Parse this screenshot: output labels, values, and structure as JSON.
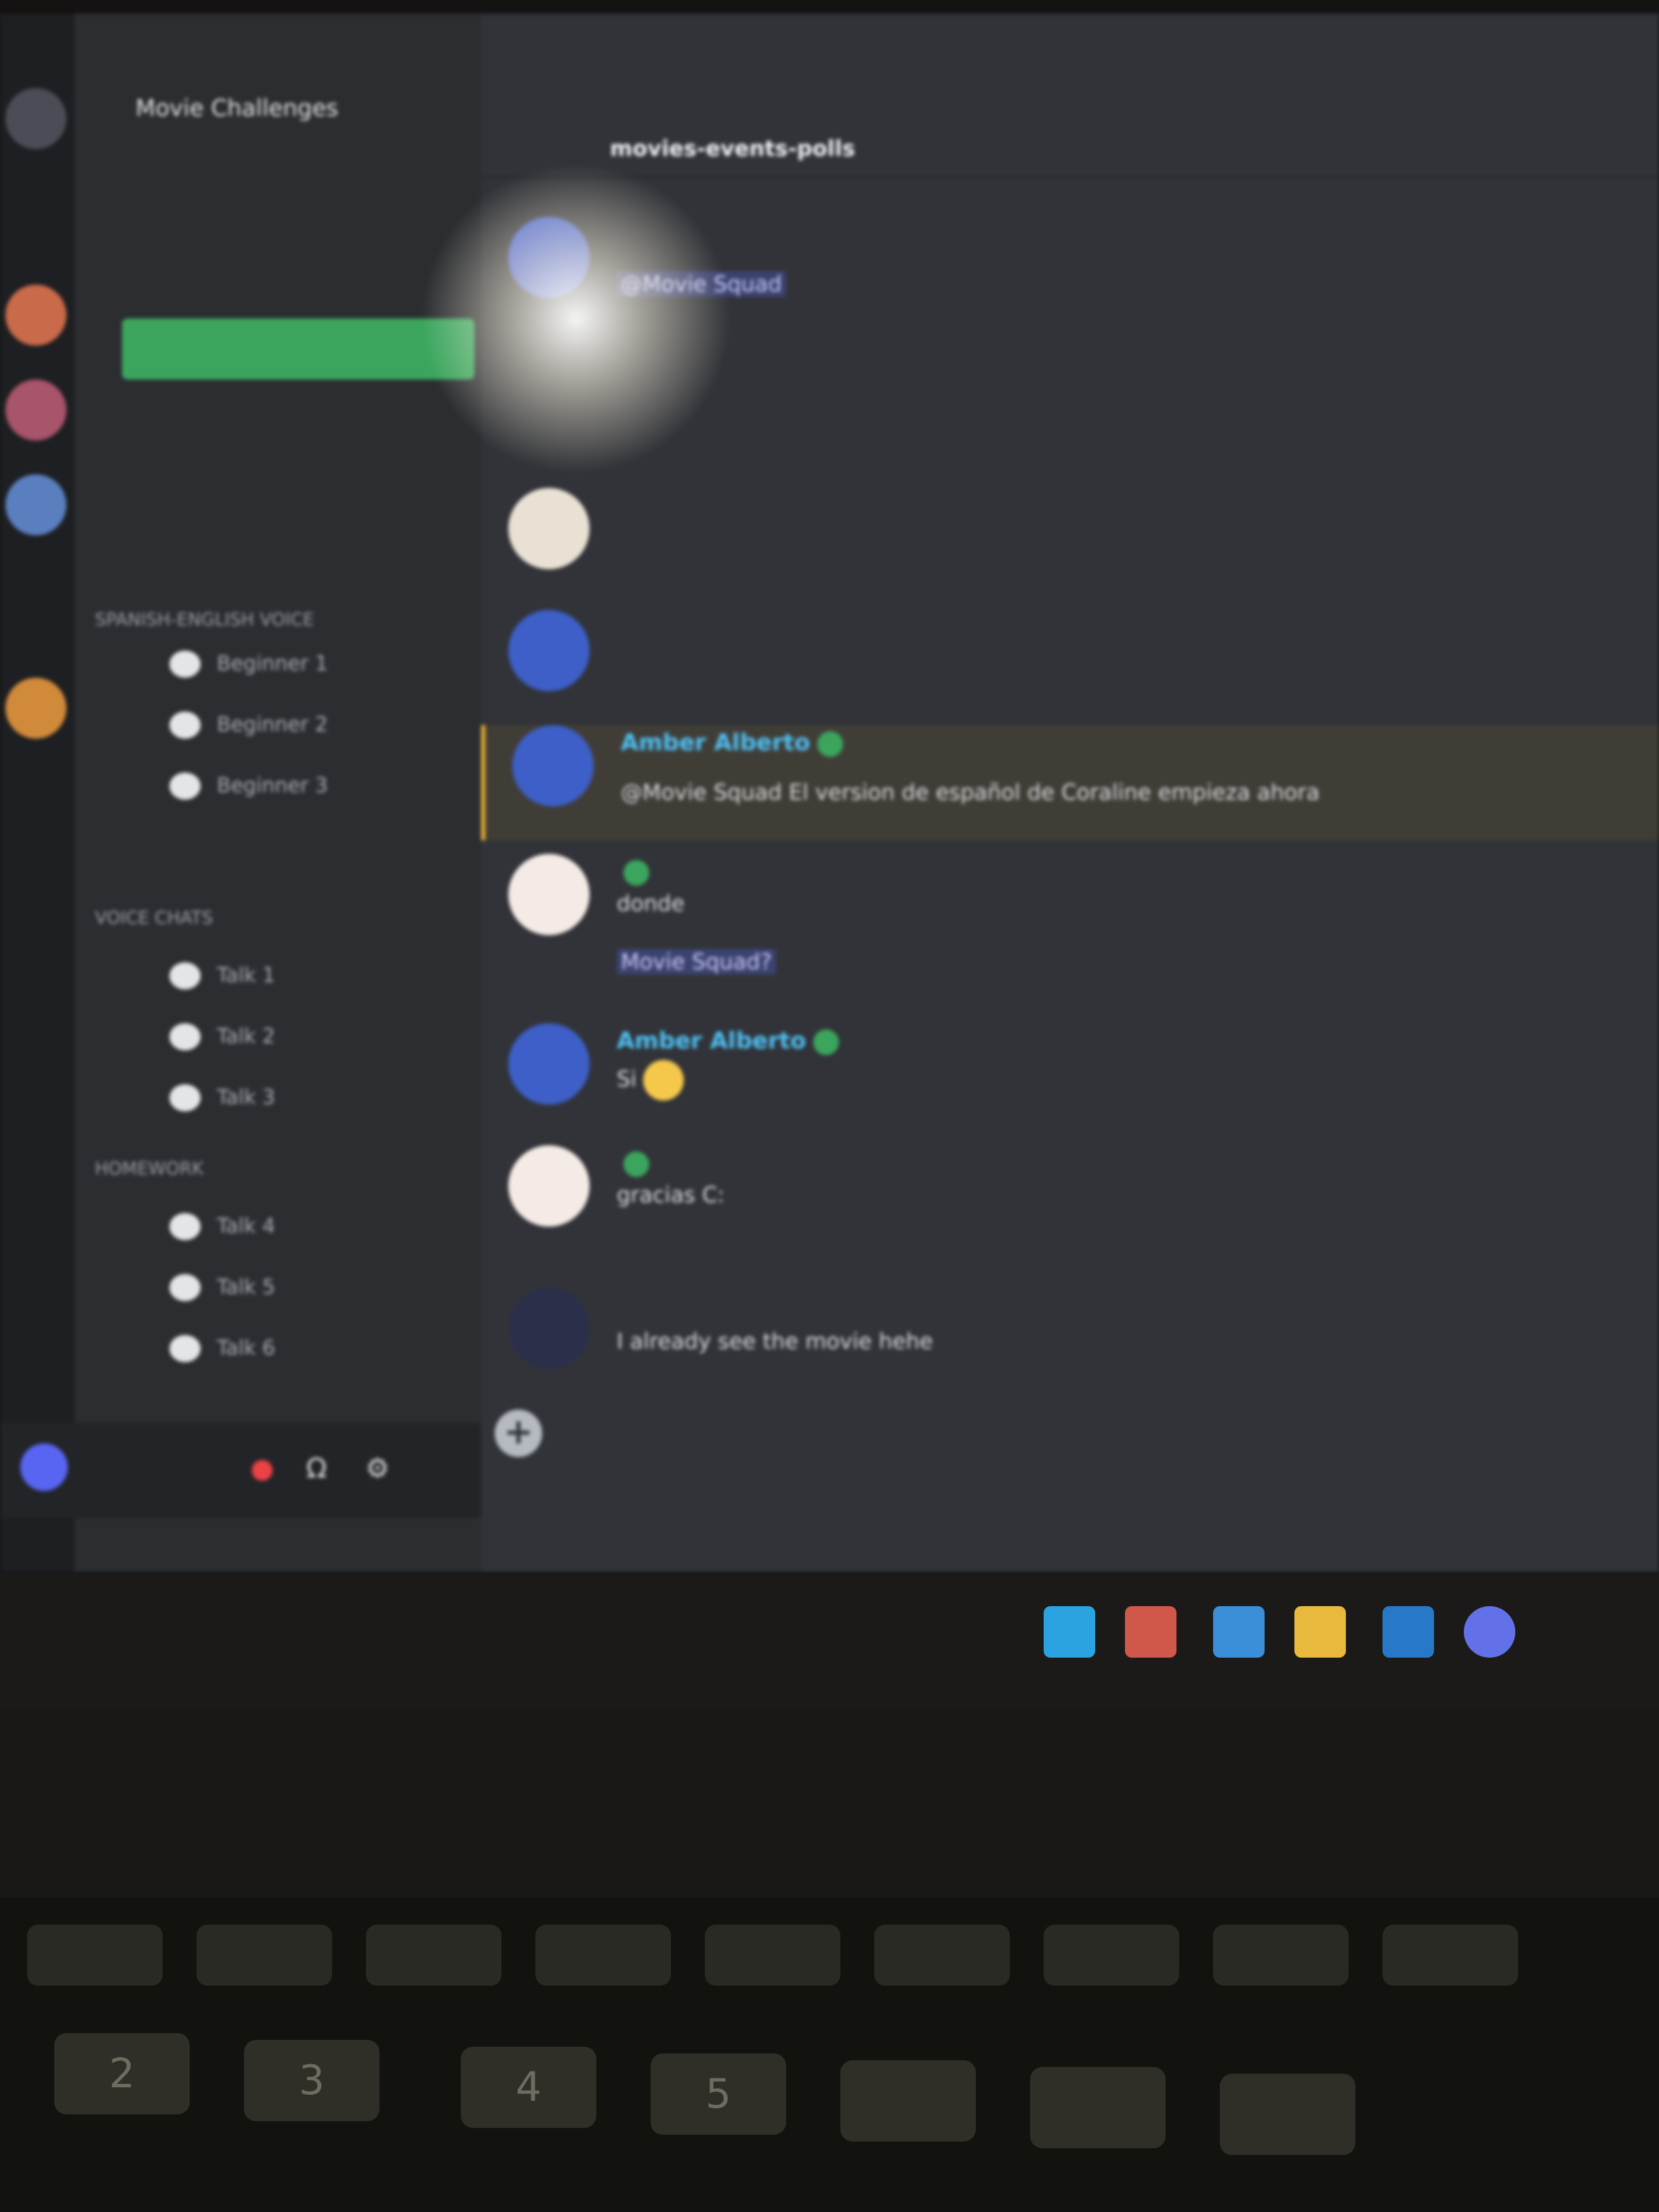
{
  "channel_sidebar": {
    "server_title": "Movie Challenges",
    "event_banner_label": "",
    "categories": [
      {
        "label": "Spanish-English Voice"
      },
      {
        "label": "Voice Chats"
      },
      {
        "label": "Homework"
      }
    ],
    "voice_channels": [
      {
        "count": "",
        "name": "Beginner 1",
        "limit": ""
      },
      {
        "count": "",
        "name": "Beginner 2",
        "limit": ""
      },
      {
        "count": "",
        "name": "Beginner 3",
        "limit": ""
      },
      {
        "count": "",
        "name": "Talk 1",
        "limit": ""
      },
      {
        "count": "",
        "name": "Talk 2",
        "limit": ""
      },
      {
        "count": "",
        "name": "Talk 3",
        "limit": ""
      },
      {
        "count": "",
        "name": "Talk 4",
        "limit": ""
      },
      {
        "count": "",
        "name": "Talk 5",
        "limit": ""
      },
      {
        "count": "",
        "name": "Talk 6",
        "limit": ""
      }
    ]
  },
  "user_panel": {
    "username": "",
    "status": ""
  },
  "header": {
    "channel_name": "movies-events-polls",
    "topic": ""
  },
  "messages": [
    {
      "author": "",
      "author_color": "#8ea1e1",
      "timestamp": "",
      "text": "@Movie Squad"
    },
    {
      "author": "",
      "author_color": "#d4a017",
      "timestamp": "",
      "text": ""
    },
    {
      "author": "",
      "author_color": "#d4a017",
      "timestamp": "",
      "text": ""
    },
    {
      "author": "",
      "author_color": "#4fc3f7",
      "timestamp": "",
      "text": ""
    },
    {
      "author": "Amber Alberto",
      "author_color": "#4fc3f7",
      "timestamp": "",
      "text": "@Movie Squad  El version de español de Coraline empieza ahora"
    },
    {
      "author": "",
      "author_color": "#3ba55d",
      "timestamp": "",
      "text": "donde",
      "extra": "Movie Squad?"
    },
    {
      "author": "Amber Alberto",
      "author_color": "#4fc3f7",
      "timestamp": "",
      "text": "Si"
    },
    {
      "author": "",
      "author_color": "#3ba55d",
      "timestamp": "",
      "text": "gracias C:"
    },
    {
      "author": "",
      "author_color": "#5aa9ff",
      "timestamp": "",
      "reply": "",
      "text": "I already see the movie hehe"
    }
  ],
  "composer": {
    "placeholder": ""
  },
  "colors": {
    "background": "#313338",
    "sidebar": "#2b2d31",
    "rail": "#1e1f22",
    "accent_green": "#3ba55d",
    "mention_bg": "#3c4270"
  },
  "icons": {
    "headphones": "headphones-icon",
    "settings": "gear-icon",
    "mic": "mic-icon",
    "add": "plus-icon"
  },
  "keyboard": {
    "keys": [
      "2",
      "3",
      "4",
      "5"
    ]
  }
}
